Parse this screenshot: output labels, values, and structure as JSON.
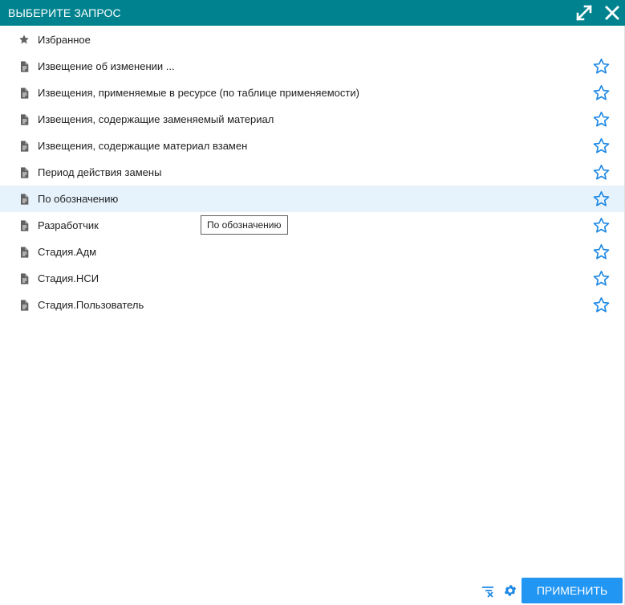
{
  "dialog": {
    "title": "ВЫБЕРИТЕ ЗАПРОС",
    "expand_icon": "expand-icon",
    "close_icon": "close-icon"
  },
  "favorites_header": {
    "label": "Избранное",
    "icon": "star-filled-icon"
  },
  "queries": [
    {
      "label": "Извещение об изменении ...",
      "selected": false
    },
    {
      "label": "Извещения, применяемые в ресурсе (по таблице применяемости)",
      "selected": false
    },
    {
      "label": "Извещения, содержащие заменяемый материал",
      "selected": false
    },
    {
      "label": "Извещения, содержащие материал взамен",
      "selected": false
    },
    {
      "label": "Период действия замены",
      "selected": false
    },
    {
      "label": "По обозначению",
      "selected": true
    },
    {
      "label": "Разработчик",
      "selected": false
    },
    {
      "label": "Стадия.Адм",
      "selected": false
    },
    {
      "label": "Стадия.НСИ",
      "selected": false
    },
    {
      "label": "Стадия.Пользователь",
      "selected": false
    }
  ],
  "tooltip": {
    "text": "По обозначению"
  },
  "footer": {
    "apply_label": "ПРИМЕНИТЬ",
    "clear_filter_icon": "clear-filter-icon",
    "settings_icon": "gear-icon"
  },
  "colors": {
    "header_bg": "#00838f",
    "selected_row_bg": "#e6f3fc",
    "star_outline": "#1e88e5",
    "apply_button": "#2196f3",
    "doc_icon": "#616161"
  }
}
